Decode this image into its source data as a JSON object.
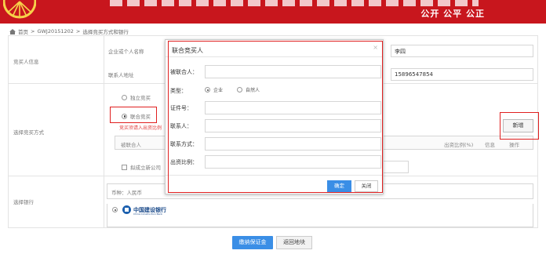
{
  "banner": {
    "slogan": "公开 公平 公正"
  },
  "breadcrumb": {
    "home": "首页",
    "sep1": ">",
    "code": "GWJ20151202",
    "sep2": ">",
    "current": "选择竞买方式和银行"
  },
  "bidder_info": {
    "section_label": "竞买人信息",
    "name_label": "企业或个人名称",
    "name_value": "李四",
    "address_label": "联系人地址",
    "phone_value": "15896547854"
  },
  "bid_mode": {
    "section_label": "选择竞买方式",
    "independent_label": "独立竞买",
    "joint_label": "联合竞买",
    "joint_selected": true,
    "hint": "竞买须请入出资比例",
    "table_headers": {
      "joint_person": "被联合人",
      "ratio": "出资比例(%)",
      "info": "信息",
      "action": "操作"
    },
    "add_button": "新增",
    "new_company_label": "拟成立新公司"
  },
  "bank": {
    "section_label": "选择银行",
    "currency": "币种：人民币",
    "bank_name": "中国建设银行",
    "bank_name_en": "China Construction Bank"
  },
  "footer": {
    "pay_button": "缴纳保证金",
    "back_button": "返回地块"
  },
  "modal": {
    "title": "联合竞买人",
    "close": "×",
    "fields": {
      "joint_person": "被联合人：",
      "type": "类型：",
      "id_no": "证件号：",
      "contact": "联系人：",
      "contact_method": "联系方式：",
      "ratio": "出资比例："
    },
    "type_options": [
      "企业",
      "自然人"
    ],
    "type_selected": "企业",
    "ok_button": "确定",
    "cancel_button": "关闭"
  },
  "colors": {
    "banner": "#c8161d",
    "primary": "#3a8ee6",
    "highlight": "#e02020"
  }
}
